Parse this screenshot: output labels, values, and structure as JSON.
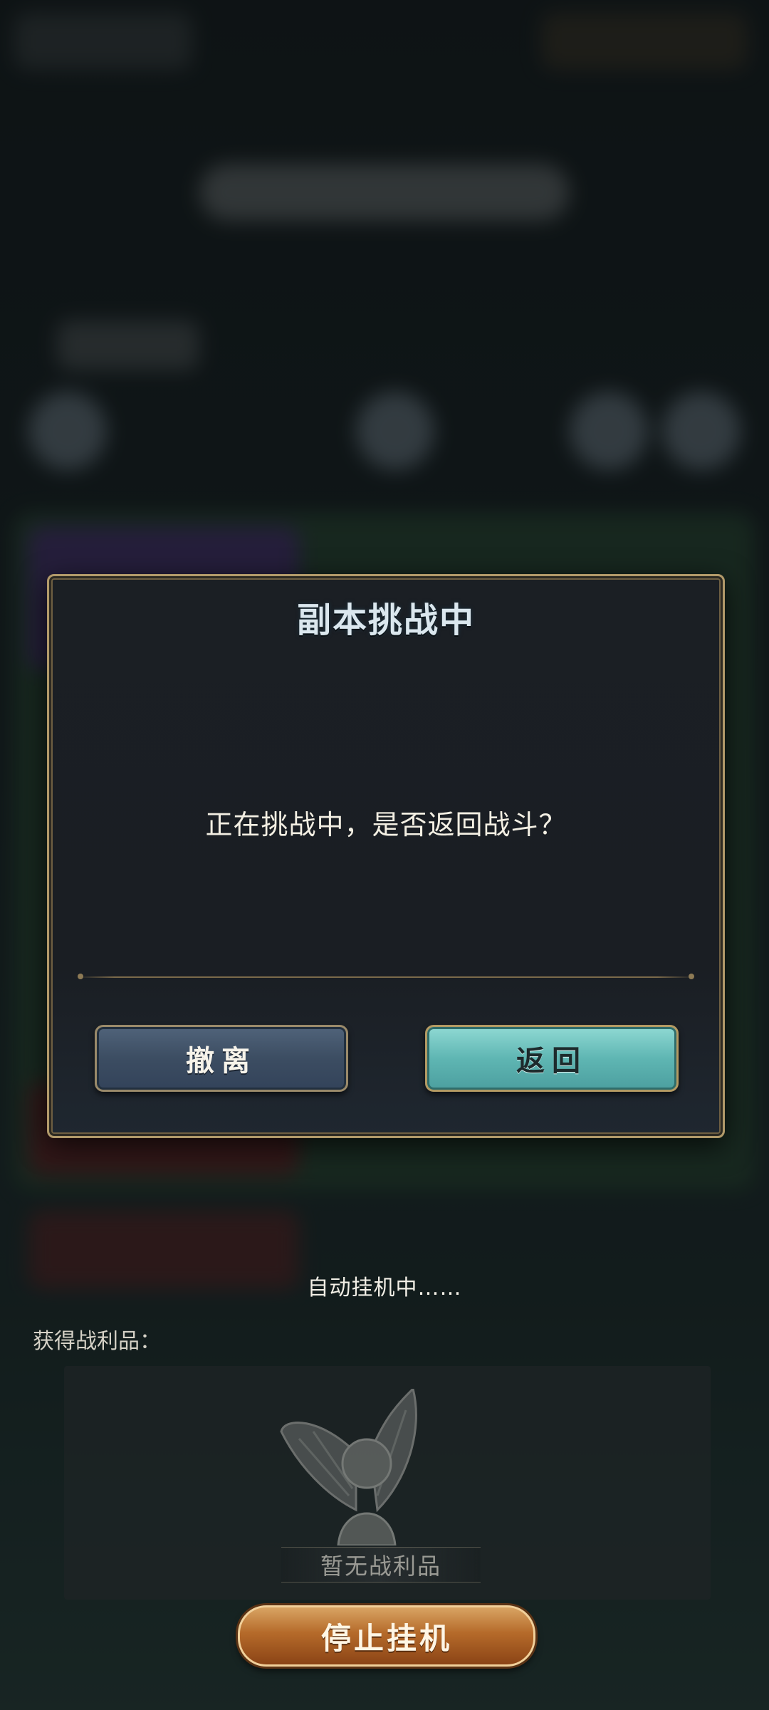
{
  "modal": {
    "title": "副本挑战中",
    "message": "正在挑战中，是否返回战斗？",
    "retreat_label": "撤离",
    "return_label": "返回"
  },
  "idle": {
    "status_text": "自动挂机中……",
    "loot_label": "获得战利品：",
    "no_loot_text": "暂无战利品",
    "stop_label": "停止挂机"
  },
  "colors": {
    "accent_gold": "#b29a6a",
    "return_button": "#5fb6b3",
    "retreat_button": "#3c4d62",
    "stop_button": "#b56a2a"
  },
  "icons": {
    "loot_placeholder": "fairy-placeholder-icon"
  }
}
